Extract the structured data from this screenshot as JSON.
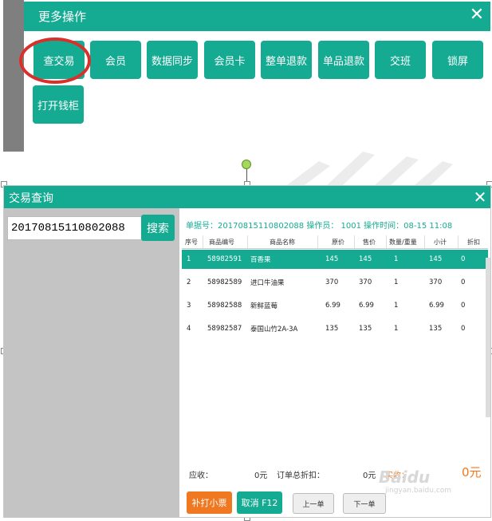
{
  "more_ops": {
    "title": "更多操作",
    "close": "✕",
    "buttons": [
      "查交易",
      "会员",
      "数据同步",
      "会员卡",
      "整单退款",
      "单品退款",
      "交班",
      "锁屏",
      "打开钱柜"
    ]
  },
  "dialog": {
    "title": "交易查询",
    "close": "✕",
    "search_value": "20170815110802088",
    "search_button": "搜索",
    "info": "单据号：20170815110802088 操作员： 1001    操作时间：08-15 11:08",
    "columns": [
      "序号",
      "商品编号",
      "商品名称",
      "原价",
      "售价",
      "数量/重量",
      "小计",
      "折扣"
    ],
    "rows": [
      [
        "1",
        "58982591",
        "百香果",
        "145",
        "145",
        "1",
        "145",
        "0"
      ],
      [
        "2",
        "58982589",
        "进口牛油果",
        "370",
        "370",
        "1",
        "370",
        "0"
      ],
      [
        "3",
        "58982588",
        "新鲜蓝莓",
        "6.99",
        "6.99",
        "1",
        "6.99",
        "0"
      ],
      [
        "4",
        "58982587",
        "泰国山竹2A-3A",
        "135",
        "135",
        "1",
        "135",
        "0"
      ]
    ],
    "summary": {
      "due_label": "应收：",
      "due_value": "0元",
      "discount_label": "订单总折扣：",
      "discount_value": "0元",
      "paid_label": "实收：",
      "paid_value": "0元"
    },
    "buttons": {
      "reprint": "补打小票",
      "cancel": "取消 F12",
      "prev": "上一单",
      "next": "下一单"
    }
  },
  "watermark": {
    "brand": "Baidu",
    "sub": "jingyan.baidu.com"
  },
  "colors": {
    "accent": "#15ab93",
    "highlight": "#d9302c",
    "orange": "#f07820"
  }
}
